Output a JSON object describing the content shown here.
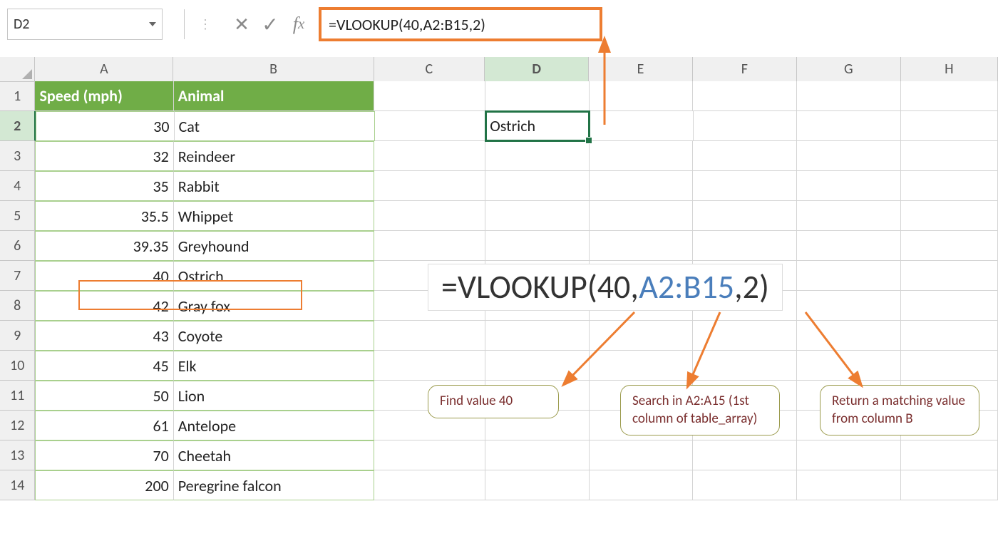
{
  "namebox": {
    "value": "D2"
  },
  "formula_bar": {
    "formula": "=VLOOKUP(40,A2:B15,2)"
  },
  "columns": [
    "A",
    "B",
    "C",
    "D",
    "E",
    "F",
    "G",
    "H"
  ],
  "selected_column": "D",
  "selected_row": 2,
  "table": {
    "headers": {
      "a": "Speed (mph)",
      "b": "Animal"
    },
    "rows": [
      {
        "speed": "30",
        "animal": "Cat"
      },
      {
        "speed": "32",
        "animal": "Reindeer"
      },
      {
        "speed": "35",
        "animal": "Rabbit"
      },
      {
        "speed": "35.5",
        "animal": "Whippet"
      },
      {
        "speed": "39.35",
        "animal": "Greyhound"
      },
      {
        "speed": "40",
        "animal": "Ostrich"
      },
      {
        "speed": "42",
        "animal": "Gray fox"
      },
      {
        "speed": "43",
        "animal": "Coyote"
      },
      {
        "speed": "45",
        "animal": "Elk"
      },
      {
        "speed": "50",
        "animal": "Lion"
      },
      {
        "speed": "61",
        "animal": "Antelope"
      },
      {
        "speed": "70",
        "animal": "Cheetah"
      },
      {
        "speed": "200",
        "animal": "Peregrine falcon"
      }
    ]
  },
  "result_cell": {
    "value": "Ostrich"
  },
  "big_formula": {
    "p1": "=VLOOKUP(",
    "p2": "40",
    "p3": ",",
    "p4": "A2:B15",
    "p5": ",",
    "p6": "2",
    "p7": ")"
  },
  "callouts": {
    "c1": "Find value 40",
    "c2": "Search in A2:A15 (1st column of table_array)",
    "c3": "Return a matching value from column B"
  }
}
